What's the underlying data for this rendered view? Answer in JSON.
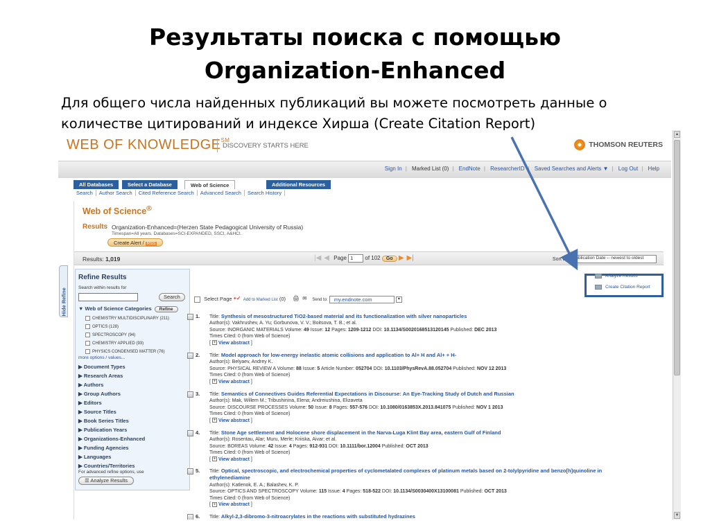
{
  "slide": {
    "title_line1": "Результаты поиска с помощью",
    "title_line2": "Organization-Enhanced",
    "text_line1": "Для общего числа найденных публикаций вы можете посмотреть данные о",
    "text_line2": "количестве цитирований и индексе Хирша (Create Citation Report)"
  },
  "header": {
    "logo": "WEB OF KNOWLEDGE",
    "logo_tm": "SM",
    "tagline": "DISCOVERY STARTS HERE",
    "brand": "THOMSON REUTERS"
  },
  "topnav": {
    "sign_in": "Sign In",
    "marked_list": "Marked List (0)",
    "endnote": "EndNote",
    "researcherid": "ResearcherID",
    "saved": "Saved Searches and Alerts ▼",
    "logout": "Log Out",
    "help": "Help"
  },
  "tabs": {
    "all_db": "All Databases",
    "select_db": "Select a Database",
    "wos": "Web of Science",
    "additional": "Additional Resources"
  },
  "subtabs": [
    "Search",
    "Author Search",
    "Cited Reference Search",
    "Advanced Search",
    "Search History"
  ],
  "main": {
    "wos_title": "Web of Science",
    "wos_reg": "®",
    "results_label": "Results",
    "query": "Organization-Enhanced=(Herzen State Pedagogical University of Russia)",
    "timespan": "Timespan=All years. Databases=SCI-EXPANDED, SSCI, A&HCI.",
    "create_alert": "Create Alert /",
    "rss": "RSS",
    "results_count_label": "Results:",
    "results_count": "1,019",
    "page_label": "Page",
    "page_value": "1",
    "of_pages": "of 102",
    "go": "Go",
    "sort_label": "Sort by:",
    "sort_value": "Publication Date -- newest to oldest"
  },
  "refine": {
    "hide": "Hide Refine",
    "title": "Refine Results",
    "within": "Search within results for",
    "search_btn": "Search",
    "cat_header": "▼ Web of Science Categories",
    "refine_btn": "Refine",
    "categories": [
      "CHEMISTRY MULTIDISCIPLINARY (211)",
      "OPTICS (128)",
      "SPECTROSCOPY (94)",
      "CHEMISTRY APPLIED (93)",
      "PHYSICS CONDENSED MATTER (76)"
    ],
    "more": "more options / values...",
    "facets": [
      "▶ Document Types",
      "▶ Research Areas",
      "▶ Authors",
      "▶ Group Authors",
      "▶ Editors",
      "▶ Source Titles",
      "▶ Book Series Titles",
      "▶ Publication Years",
      "▶ Organizations-Enhanced",
      "▶ Funding Agencies",
      "▶ Languages",
      "▶ Countries/Territories"
    ],
    "adv_note": "For advanced refine options, use",
    "analyze_btn": "Analyze Results"
  },
  "toolbar": {
    "select_page": "Select Page",
    "add_marked": "Add to Marked List",
    "marked_count": "(0)",
    "send_to": "Send to:",
    "endnote_sel": "my.endnote.com"
  },
  "analysis_links": {
    "analyze": "Analyze Results",
    "citation": "Create Citation Report"
  },
  "records": [
    {
      "num": "1.",
      "title": "Synthesis of mesostructured TiO2-based material and its functionalization with silver nanoparticles",
      "authors": "Author(s): Vakhrushev, A. Yu; Gorbunova, V. V.; Boitsova, T. B.; et al.",
      "source_pre": "Source: INORGANIC MATERIALS  Volume: ",
      "volume": "49",
      "issue_pre": "  Issue: ",
      "issue": "12",
      "pages_pre": "  Pages: ",
      "pages": "1209-1212",
      "doi_pre": "  DOI: ",
      "doi": "10.1134/S0020168513120145",
      "pub_pre": "  Published: ",
      "pub": "DEC 2013",
      "times": "Times Cited:  0  (from Web of Science)"
    },
    {
      "num": "2.",
      "title": "Model approach for low-energy inelastic atomic collisions and application to Al+ H and Al+ + H-",
      "authors": "Author(s): Belyaev, Andrey K.",
      "source_pre": "Source: PHYSICAL REVIEW A  Volume: ",
      "volume": "88",
      "issue_pre": "  Issue: ",
      "issue": "5",
      "pages_pre": "   Article Number: ",
      "pages": "052704",
      "doi_pre": "  DOI: ",
      "doi": "10.1103/PhysRevA.88.052704",
      "pub_pre": "  Published: ",
      "pub": "NOV 12 2013",
      "times": "Times Cited:  0  (from Web of Science)"
    },
    {
      "num": "3.",
      "title": "Semantics of Connectives Guides Referential Expectations in Discourse: An Eye-Tracking Study of Dutch and Russian",
      "authors": "Author(s): Mak, Willem M.; Tribushinina, Elena; Andreiushina, Elizaveta",
      "source_pre": "Source: DISCOURSE PROCESSES  Volume: ",
      "volume": "50",
      "issue_pre": "  Issue: ",
      "issue": "8",
      "pages_pre": "  Pages: ",
      "pages": "557-576",
      "doi_pre": "  DOI: ",
      "doi": "10.1080/0163853X.2013.841075",
      "pub_pre": "  Published: ",
      "pub": "NOV 1 2013",
      "times": "Times Cited:  0  (from Web of Science)"
    },
    {
      "num": "4.",
      "title": "Stone Age settlement and Holocene shore displacement in the Narva-Luga Klint Bay area, eastern Gulf of Finland",
      "authors": "Author(s): Rosentau, Alar; Muru, Merle; Kriiska, Aivar; et al.",
      "source_pre": "Source: BOREAS  Volume: ",
      "volume": "42",
      "issue_pre": "  Issue: ",
      "issue": "4",
      "pages_pre": "  Pages: ",
      "pages": "912-931",
      "doi_pre": "  DOI: ",
      "doi": "10.1111/bor.12004",
      "pub_pre": "  Published: ",
      "pub": "OCT 2013",
      "times": "Times Cited:  0  (from Web of Science)"
    },
    {
      "num": "5.",
      "title": "Optical, spectroscopic, and electrochemical properties of cyclometalated complexes of platinum metals based on 2-tolylpyridine and benzo[h]quinoline in ethylenediamine",
      "authors": "Author(s): Katlenok, E. A.; Balashev, K. P.",
      "source_pre": "Source: OPTICS AND SPECTROSCOPY  Volume: ",
      "volume": "115",
      "issue_pre": "  Issue: ",
      "issue": "4",
      "pages_pre": "  Pages: ",
      "pages": "518-522",
      "doi_pre": "  DOI: ",
      "doi": "10.1134/S0030400X13100081",
      "pub_pre": "  Published: ",
      "pub": "OCT 2013",
      "times": "Times Cited:  0  (from Web of Science)"
    },
    {
      "num": "6.",
      "title": "Alkyl-2,3-dibromo-3-nitroacrylates in the reactions with substituted hydrazines"
    }
  ],
  "view_abstract": "View abstract",
  "colors": {
    "accent_orange": "#c8741f",
    "link_blue": "#2756a0",
    "tab_blue": "#2b5f9e",
    "highlight_box": "#2f5f9a"
  }
}
